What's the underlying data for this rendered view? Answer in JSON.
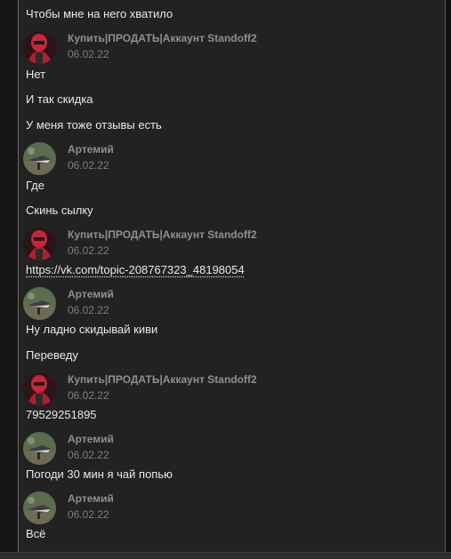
{
  "messages": [
    {
      "type": "text",
      "text": "Чтобы мне на него хватило"
    },
    {
      "type": "header",
      "author": "Купить|ПРОДАТЬ|Аккаунт Standoff2",
      "date": "06.02.22",
      "avatar": "shop-avatar-icon"
    },
    {
      "type": "text",
      "text": "Нет"
    },
    {
      "type": "text",
      "text": "И так скидка"
    },
    {
      "type": "text",
      "text": "У меня тоже отзывы есть"
    },
    {
      "type": "header",
      "author": "Артемий",
      "date": "06.02.22",
      "avatar": "user-avatar-icon"
    },
    {
      "type": "text",
      "text": "Где"
    },
    {
      "type": "text",
      "text": "Скинь сылку"
    },
    {
      "type": "header",
      "author": "Купить|ПРОДАТЬ|Аккаунт Standoff2",
      "date": "06.02.22",
      "avatar": "shop-avatar-icon"
    },
    {
      "type": "link",
      "text": "https://vk.com/topic-208767323_48198054"
    },
    {
      "type": "header",
      "author": "Артемий",
      "date": "06.02.22",
      "avatar": "user-avatar-icon"
    },
    {
      "type": "text",
      "text": "Ну ладно скидывай киви"
    },
    {
      "type": "text",
      "text": "Переведу"
    },
    {
      "type": "header",
      "author": "Купить|ПРОДАТЬ|Аккаунт Standoff2",
      "date": "06.02.22",
      "avatar": "shop-avatar-icon"
    },
    {
      "type": "text",
      "text": "79529251895"
    },
    {
      "type": "header",
      "author": "Артемий",
      "date": "06.02.22",
      "avatar": "user-avatar-icon"
    },
    {
      "type": "text",
      "text": "Погоди 30 мин я чай попью"
    },
    {
      "type": "header",
      "author": "Артемий",
      "date": "06.02.22",
      "avatar": "user-avatar-icon"
    },
    {
      "type": "text",
      "text": "Всё"
    }
  ],
  "colors": {
    "background": "#222222",
    "text": "#e8e8e8",
    "author": "#8f8f8f",
    "date": "#7d7d7d"
  }
}
